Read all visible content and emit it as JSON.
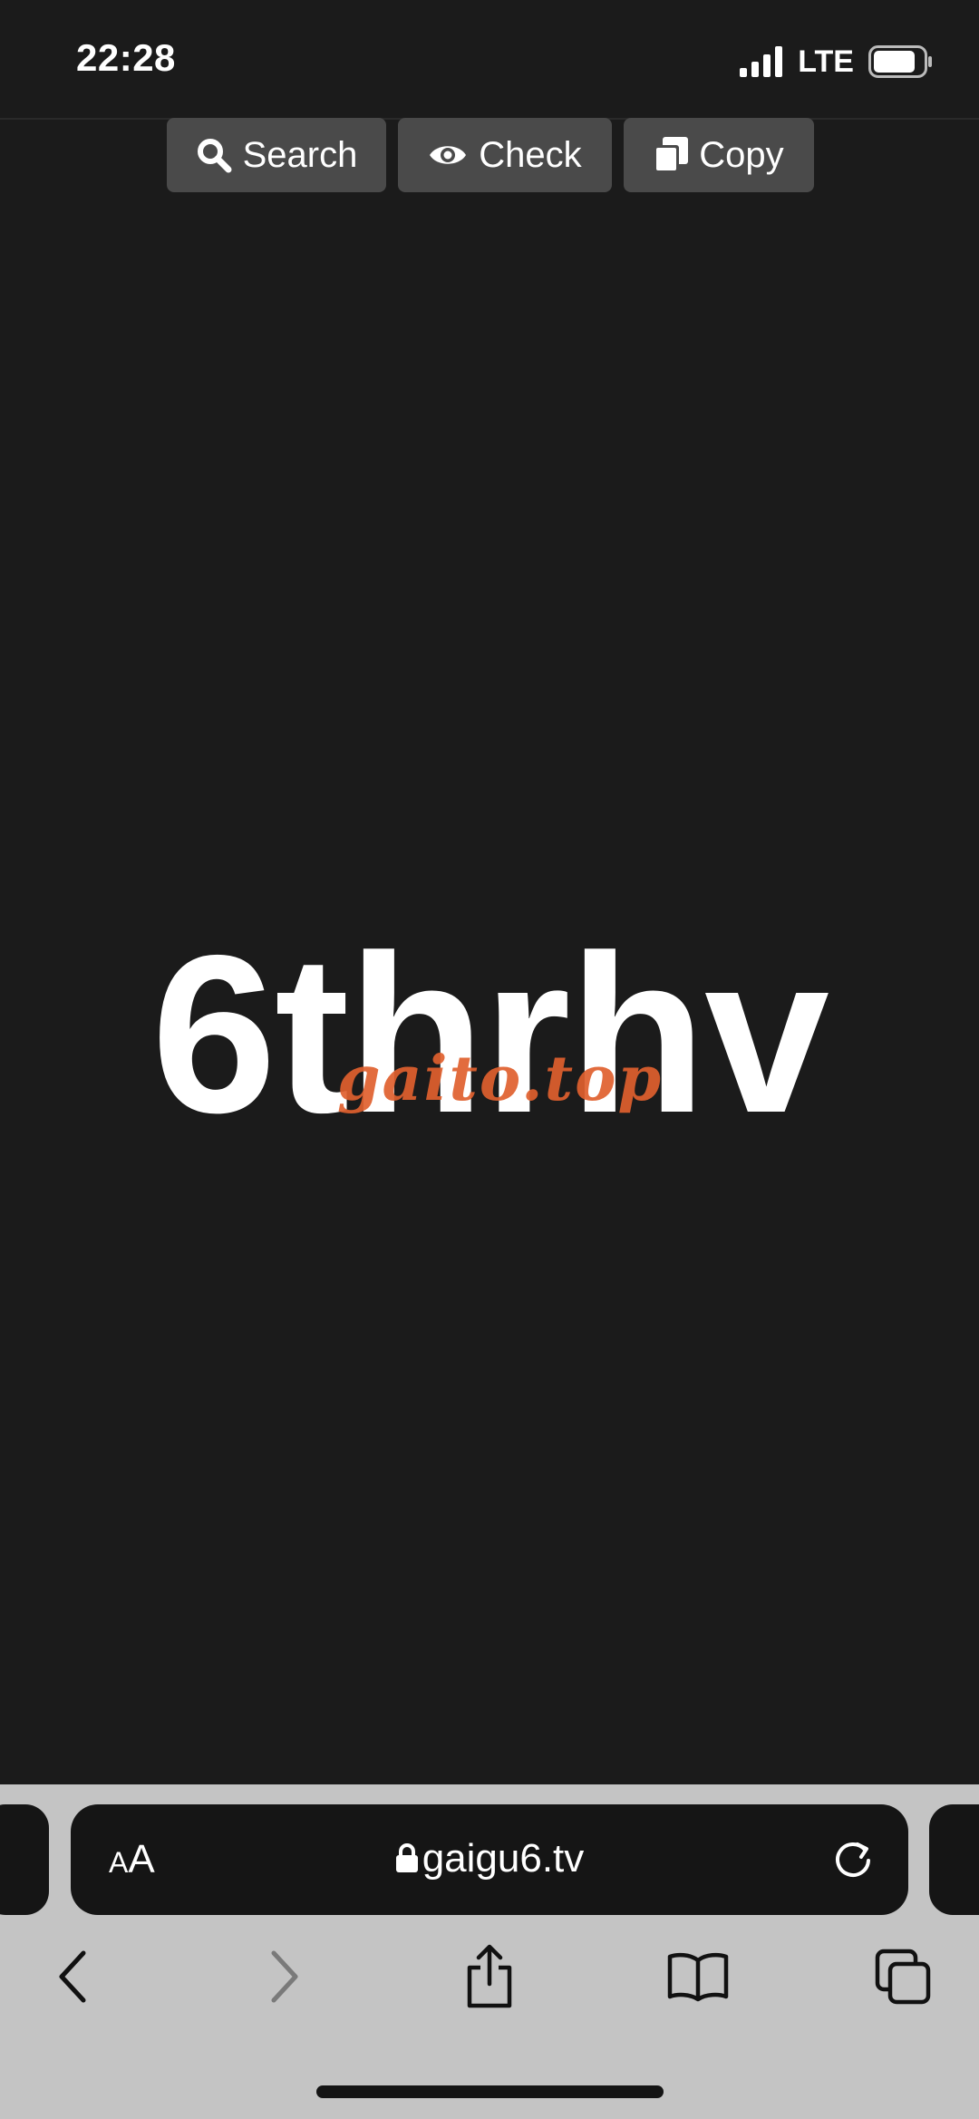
{
  "status_bar": {
    "time": "22:28",
    "network": "LTE"
  },
  "actions": {
    "search_label": "Search",
    "check_label": "Check",
    "copy_label": "Copy"
  },
  "main": {
    "code": "6thrhv",
    "watermark": "gaito.top"
  },
  "browser": {
    "text_size_label_small": "A",
    "text_size_label_large": "A",
    "url": "gaigu6.tv"
  },
  "colors": {
    "background": "#1b1b1b",
    "button": "#4a4a4a",
    "watermark": "#e0602e",
    "toolbar": "#c4c4c4",
    "address_bar": "#151515"
  },
  "icons": {
    "search": "search-icon",
    "check": "eye-icon",
    "copy": "copy-icon",
    "lock": "lock-icon",
    "reload": "reload-icon",
    "back": "chevron-left-icon",
    "forward": "chevron-right-icon",
    "share": "share-icon",
    "bookmarks": "book-icon",
    "tabs": "tabs-icon"
  }
}
